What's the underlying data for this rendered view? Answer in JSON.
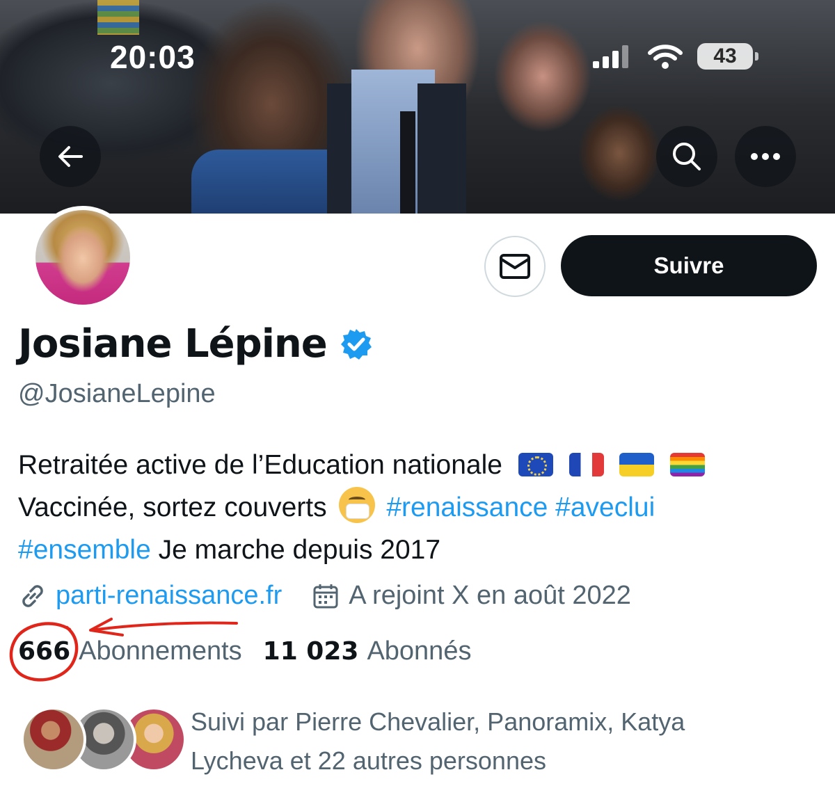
{
  "status_bar": {
    "time": "20:03",
    "battery": "43"
  },
  "header": {
    "back_icon": "arrow-left-icon",
    "search_icon": "search-icon",
    "more_icon": "more-horizontal-icon"
  },
  "profile": {
    "name": "Josiane Lépine",
    "handle": "@JosianeLepine",
    "verified": true,
    "follow_label": "Suivre",
    "bio": {
      "line1_text": "Retraitée active de l’Education nationale",
      "flags": [
        "flag-eu",
        "flag-france",
        "flag-ukraine",
        "flag-rainbow"
      ],
      "line2_text": "Vaccinée, sortez couverts",
      "emoji": "face-with-medical-mask",
      "hashtag1": "#renaissance",
      "hashtag2": "#aveclui",
      "hashtag3": "#ensemble",
      "line3_text": "Je marche depuis 2017"
    },
    "website": "parti-renaissance.fr",
    "joined": "A rejoint X en août 2022",
    "following_count": "666",
    "following_label": "Abonnements",
    "followers_count": "11 023",
    "followers_label": "Abonnés",
    "followed_by": "Suivi par Pierre Chevalier, Panoramix, Katya Lycheva et 22 autres personnes"
  },
  "colors": {
    "accent": "#1d9bf0",
    "text": "#0f1419",
    "secondary_text": "#536471",
    "button_dark": "#0f1419",
    "annotation_red": "#e0261b"
  }
}
